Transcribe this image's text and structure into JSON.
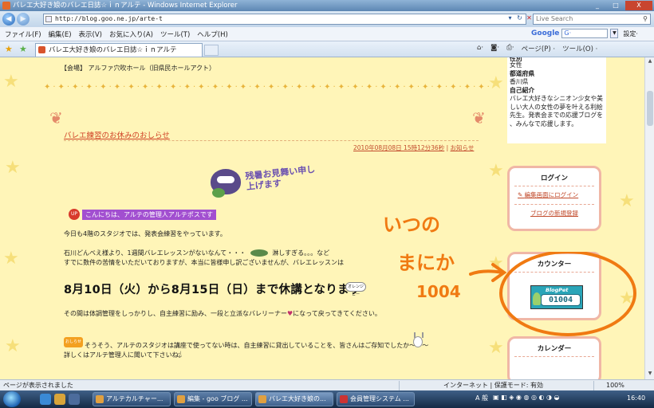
{
  "window": {
    "title": "バレエ大好き娘のバレエ日誌☆ｉｎアルテ - Windows Internet Explorer",
    "controls": [
      "_",
      "□",
      "X"
    ]
  },
  "browser": {
    "url": "http://blog.goo.ne.jp/arte-t",
    "live_search_placeholder": "Live Search",
    "menu": [
      "ファイル(F)",
      "編集(E)",
      "表示(V)",
      "お気に入り(A)",
      "ツール(T)",
      "ヘルプ(H)"
    ],
    "google_label": "Google",
    "google_box": "G·",
    "settings_label": "設定·",
    "tab_title": "バレエ大好き娘のバレエ日誌☆ｉｎアルテ",
    "command_bar": [
      "ページ(P) ·",
      "ツール(O) ·"
    ]
  },
  "page": {
    "venue": "【会場】 アルファ穴吹ホール（旧県民ホールアクト）",
    "post_title": "バレエ練習のお休みのおしらせ",
    "post_meta_date": "2010年08月08日 15時12分36秒",
    "post_meta_sep": " | ",
    "post_meta_category": "お知らせ",
    "banner_text": "残暑お見舞い申し上げます",
    "greeting": "こんにちは、アルテの管理人アルテポスです",
    "apple_badge": "UP",
    "line1": "今日も4階のスタジオでは、発表会練習をやっています。",
    "line2a": "石川どんべえ様より、1週間バレエレッスンがないなんて・・・",
    "line2b": "淋しすぎる。。。など",
    "line3": "すでに数件の苦情をいただいておりますが、本当に皆様申し訳ございませんが、バレエレッスンは",
    "big_notice": "8月10日（火）から8月15日（日）まで休講となります",
    "sticker": "オレンジヒー",
    "line4a": "その間は体調管理をしっかりし、自主練習に励み、一段と立派なバレリーナー",
    "line4b": "になって戻ってきてください。",
    "bookmark_badge": "おしらせ",
    "line5": "そうそう、アルテのスタジオは講座で使ってない時は、自主練習に貸出していることを、皆さんはご存知でしたか〜〜〜",
    "line6": "詳しくはアルテ管理人に聞いて下さいね。"
  },
  "sidebar": {
    "profile_partial_top": "性別",
    "gender": "女性",
    "pref_label": "都道府県",
    "pref": "香川県",
    "intro_label": "自己紹介",
    "intro": [
      "バレエ大好きなシニオン少女や美",
      "しい大人の女性の夢を叶える利絵",
      "先生。発表会までの応援ブログを",
      "、みんなで応援します。"
    ],
    "login_title": "ログイン",
    "login_edit": "編集画面にログイン",
    "login_register": "ブログの新規登録",
    "counter_title": "カウンター",
    "blogpet_label": "BlogPet",
    "counter_value": "01004",
    "calendar_title": "カレンダー"
  },
  "annotation": {
    "line1": "いつの",
    "line2": "まにか",
    "line3": "1004"
  },
  "statusbar": {
    "text": "ページが表示されました",
    "zone": "インターネット | 保護モード: 有効",
    "zoom": "100%"
  },
  "taskbar": {
    "tasks": [
      "アルテカルチャー...",
      "編集 - goo ブログ ...",
      "バレエ大好き娘の...",
      "会員管理システム ..."
    ],
    "ime": "A 般",
    "clock": "16:40"
  }
}
